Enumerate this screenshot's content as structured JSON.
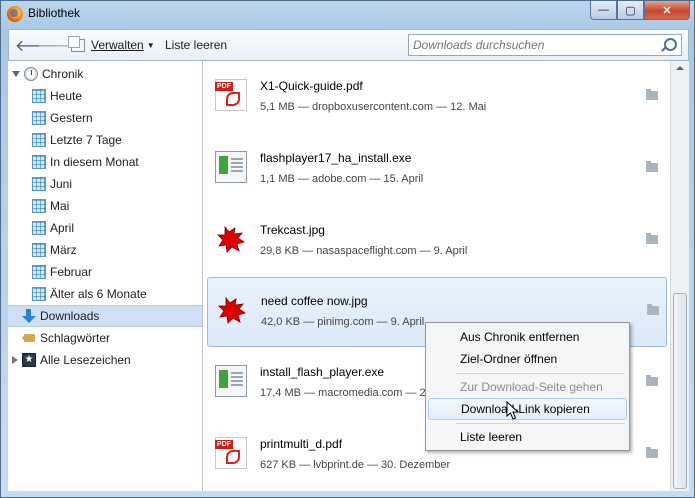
{
  "window": {
    "title": "Bibliothek",
    "buttons": {
      "minimize": "—",
      "maximize": "▢",
      "close": "✕"
    }
  },
  "toolbar": {
    "back_icon": "back-arrow",
    "forward_icon": "forward-arrow",
    "organize_label": "Verwalten",
    "clear_list_label": "Liste leeren",
    "search_placeholder": "Downloads durchsuchen"
  },
  "sidebar": {
    "history": {
      "label": "Chronik",
      "items": [
        "Heute",
        "Gestern",
        "Letzte 7 Tage",
        "In diesem Monat",
        "Juni",
        "Mai",
        "April",
        "März",
        "Februar",
        "Älter als 6 Monate"
      ]
    },
    "downloads_label": "Downloads",
    "tags_label": "Schlagwörter",
    "bookmarks_label": "Alle Lesezeichen"
  },
  "downloads": [
    {
      "name": "X1-Quick-guide.pdf",
      "meta": "5,1 MB — dropboxusercontent.com — 12. Mai",
      "type": "pdf"
    },
    {
      "name": "flashplayer17_ha_install.exe",
      "meta": "1,1 MB — adobe.com — 15. April",
      "type": "exe"
    },
    {
      "name": "Trekcast.jpg",
      "meta": "29,8 KB — nasaspaceflight.com — 9. April",
      "type": "img"
    },
    {
      "name": "need coffee now.jpg",
      "meta": "42,0 KB — pinimg.com — 9. April",
      "type": "img"
    },
    {
      "name": "install_flash_player.exe",
      "meta": "17,4 MB — macromedia.com — 2",
      "type": "exe"
    },
    {
      "name": "printmulti_d.pdf",
      "meta": "627 KB — lvbprint.de — 30. Dezember",
      "type": "pdf"
    }
  ],
  "context_menu": {
    "items": [
      {
        "label": "Aus Chronik entfernen",
        "disabled": false
      },
      {
        "label": "Ziel-Ordner öffnen",
        "disabled": false
      },
      {
        "label": "Zur Download-Seite gehen",
        "disabled": true
      },
      {
        "label": "Download-Link kopieren",
        "disabled": false
      },
      {
        "label": "Liste leeren",
        "disabled": false
      }
    ]
  },
  "colors": {
    "accent": "#2b7fd4",
    "selection": "#cfe0f5",
    "pdf_red": "#c6231b",
    "img_red": "#e00000"
  }
}
